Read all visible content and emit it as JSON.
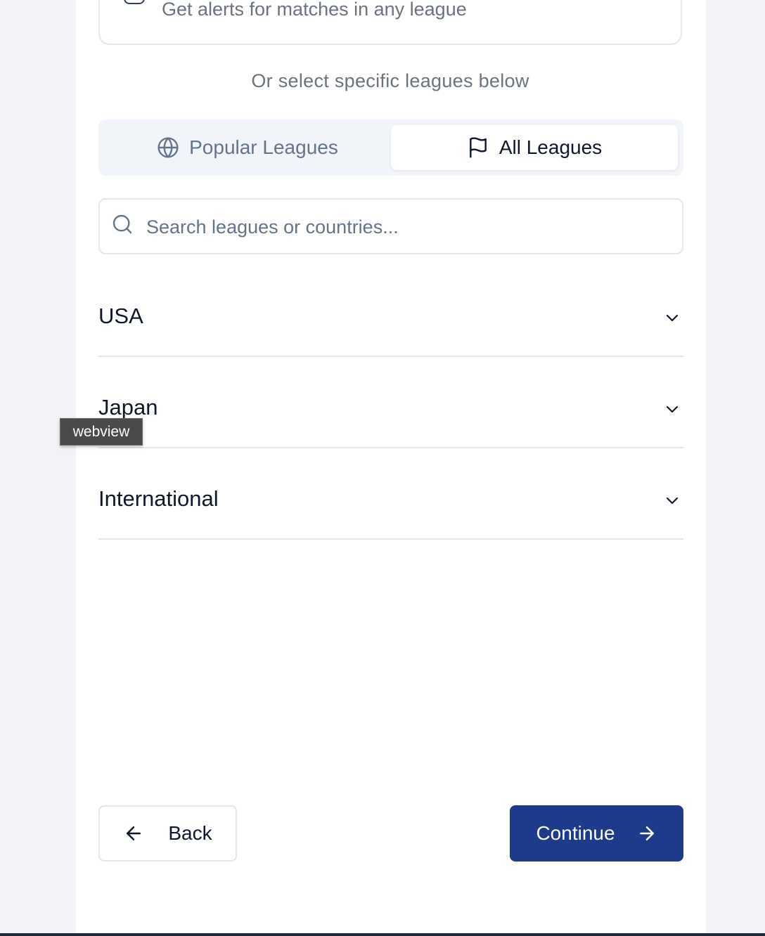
{
  "any_league": {
    "description": "Get alerts for matches in any league"
  },
  "helper_text": "Or select specific leagues below",
  "tabs": [
    {
      "label": "Popular Leagues",
      "icon": "globe-icon",
      "active": false
    },
    {
      "label": "All Leagues",
      "icon": "flag-icon",
      "active": true
    }
  ],
  "search": {
    "placeholder": "Search leagues or countries..."
  },
  "countries": [
    {
      "name": "USA"
    },
    {
      "name": "Japan"
    },
    {
      "name": "International"
    }
  ],
  "tooltip": "webview",
  "footer": {
    "back_label": "Back",
    "continue_label": "Continue"
  },
  "colors": {
    "primary": "#1e3a8a",
    "text": "#0f172a",
    "muted": "#64748b",
    "border": "#e2e8f0",
    "tab_bg": "#f1f5f9"
  }
}
